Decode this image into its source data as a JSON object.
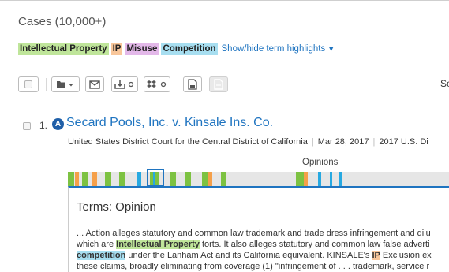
{
  "header": {
    "title": "Cases (10,000+)"
  },
  "terms": {
    "items": [
      {
        "label": "Intellectual Property",
        "color": "#bfe59a"
      },
      {
        "label": "IP",
        "color": "#f8c69a"
      },
      {
        "label": "Misuse",
        "color": "#e3b8e9"
      },
      {
        "label": "Competition",
        "color": "#a7def0"
      }
    ],
    "toggle_label": "Show/hide term highlights"
  },
  "toolbar": {
    "icons": [
      "checkbox-icon",
      "folder-icon",
      "email-icon",
      "download-icon",
      "dropbox-icon",
      "print-icon",
      "document-icon"
    ],
    "cut_text": "So"
  },
  "result": {
    "number": "1.",
    "badge": "A",
    "title": "Secard Pools, Inc. v. Kinsale Ins. Co.",
    "court": "United States District Court for the Central District of California",
    "date": "Mar 28, 2017",
    "citation": "2017 U.S. Di",
    "opinions_label": "Opinions",
    "panel": {
      "title": "Terms: Opinion",
      "line1": "... Action alleges statutory and common law trademark and trade dress infringement and dilu",
      "line2_pre": "which are ",
      "line2_hl": "Intellectual Property",
      "line2_post": " torts. It also alleges statutory and common law false adverti",
      "line3_hl": "competition",
      "line3_mid": " under the Lanham Act and its California equivalent. KINSALE's ",
      "line3_hl2": "IP",
      "line3_post": " Exclusion ex",
      "line4": "these claims, broadly eliminating from coverage (1) \"infringement of . . . trademark, service r"
    }
  }
}
